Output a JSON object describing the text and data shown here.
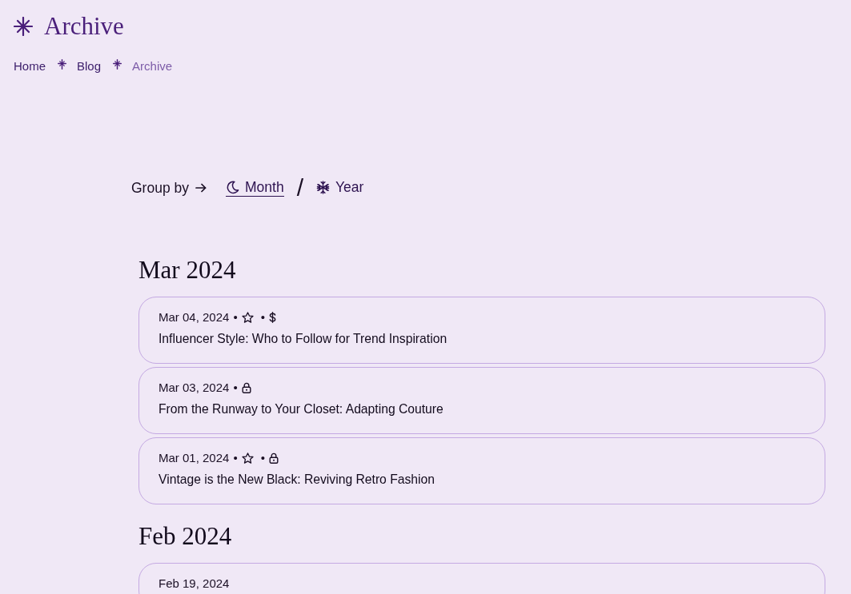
{
  "header": {
    "title": "Archive"
  },
  "breadcrumbs": [
    {
      "label": "Home",
      "current": false
    },
    {
      "label": "Blog",
      "current": false
    },
    {
      "label": "Archive",
      "current": true
    }
  ],
  "group_by": {
    "label": "Group by",
    "divider": "/",
    "options": [
      {
        "kind": "month",
        "label": "Month",
        "selected": true
      },
      {
        "kind": "year",
        "label": "Year",
        "selected": false
      }
    ]
  },
  "meta_separator": "•",
  "groups": [
    {
      "heading": "Mar 2024",
      "posts": [
        {
          "date": "Mar 04, 2024",
          "starred": true,
          "paid": true,
          "locked": false,
          "title": "Influencer Style: Who to Follow for Trend Inspiration"
        },
        {
          "date": "Mar 03, 2024",
          "starred": false,
          "paid": false,
          "locked": true,
          "title": "From the Runway to Your Closet: Adapting Couture"
        },
        {
          "date": "Mar 01, 2024",
          "starred": true,
          "paid": false,
          "locked": true,
          "title": "Vintage is the New Black: Reviving Retro Fashion"
        }
      ]
    },
    {
      "heading": "Feb 2024",
      "posts": [
        {
          "date": "Feb 19, 2024",
          "starred": false,
          "paid": false,
          "locked": false
        }
      ]
    }
  ]
}
